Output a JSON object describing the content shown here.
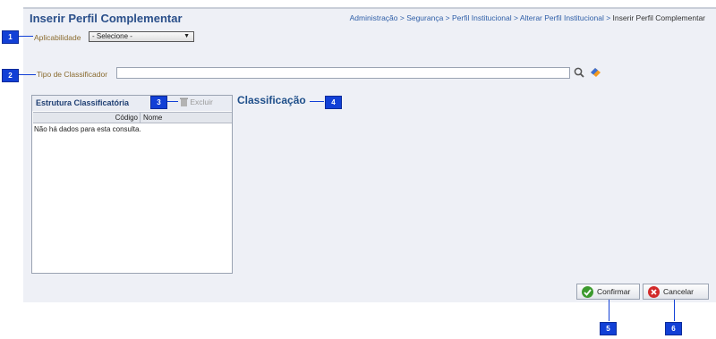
{
  "header": {
    "title": "Inserir Perfil Complementar",
    "breadcrumb": [
      "Administração",
      "Segurança",
      "Perfil Institucional",
      "Alterar Perfil Institucional"
    ],
    "breadcrumb_sep": " > ",
    "breadcrumb_current": "Inserir Perfil Complementar"
  },
  "form": {
    "aplicabilidade_label": "Aplicabilidade",
    "aplicabilidade_value": "- Selecione -",
    "tipo_label": "Tipo de Classificador",
    "tipo_value": ""
  },
  "estrutura": {
    "title": "Estrutura Classificatória",
    "excluir_label": "Excluir",
    "columns": [
      "Código",
      "Nome"
    ],
    "empty_message": "Não há dados para esta consulta."
  },
  "classificacao": {
    "title": "Classificação"
  },
  "buttons": {
    "confirmar": "Confirmar",
    "cancelar": "Cancelar"
  },
  "markers": [
    "1",
    "2",
    "3",
    "4",
    "5",
    "6"
  ],
  "colors": {
    "marker": "#1240d6",
    "title": "#2a4f8a",
    "label": "#8a6b2f",
    "panel": "#eef0f6"
  }
}
